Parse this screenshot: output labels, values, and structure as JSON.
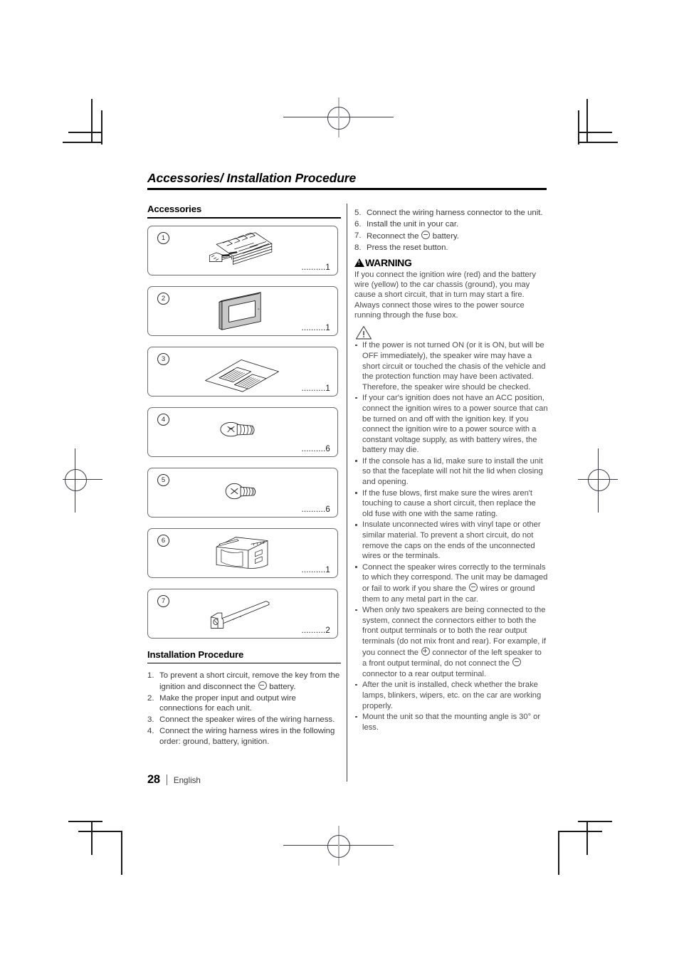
{
  "page": {
    "running_head": "Accessories/ Installation Procedure",
    "number": "28",
    "language": "English"
  },
  "accessories": {
    "section_title": "Accessories",
    "items": [
      {
        "number": "1",
        "qty": "..........1",
        "icon": "wiring-harness-icon"
      },
      {
        "number": "2",
        "qty": "..........1",
        "icon": "trim-plate-icon"
      },
      {
        "number": "3",
        "qty": "..........1",
        "icon": "label-sheet-icon"
      },
      {
        "number": "4",
        "qty": "..........6",
        "icon": "flat-head-screw-icon"
      },
      {
        "number": "5",
        "qty": "..........6",
        "icon": "pan-head-screw-icon"
      },
      {
        "number": "6",
        "qty": "..........1",
        "icon": "mounting-sleeve-icon"
      },
      {
        "number": "7",
        "qty": "..........2",
        "icon": "extraction-key-icon"
      }
    ]
  },
  "installation": {
    "section_title": "Installation Procedure",
    "steps_left": [
      {
        "n": "1.",
        "text_before": "To prevent a short circuit, remove the key from the ignition and disconnect the ",
        "symbol": "minus",
        "text_after": " battery."
      },
      {
        "n": "2.",
        "text_before": "Make the proper input and output wire connections for each unit.",
        "symbol": "",
        "text_after": ""
      },
      {
        "n": "3.",
        "text_before": "Connect the speaker wires of the wiring harness.",
        "symbol": "",
        "text_after": ""
      },
      {
        "n": "4.",
        "text_before": "Connect the wiring harness wires in the following order: ground, battery, ignition.",
        "symbol": "",
        "text_after": ""
      }
    ],
    "steps_right": [
      {
        "n": "5.",
        "text_before": "Connect the wiring harness connector to the unit.",
        "symbol": "",
        "text_after": ""
      },
      {
        "n": "6.",
        "text_before": "Install the unit in your car.",
        "symbol": "",
        "text_after": ""
      },
      {
        "n": "7.",
        "text_before": "Reconnect the ",
        "symbol": "minus",
        "text_after": " battery."
      },
      {
        "n": "8.",
        "text_before": "Press the reset button.",
        "symbol": "",
        "text_after": ""
      }
    ]
  },
  "warning": {
    "label": "WARNING",
    "body": "If you connect the ignition wire (red) and the battery wire (yellow) to the car chassis (ground), you may cause a short circuit, that in turn may start a fire. Always connect those wires to the power source running through the fuse box."
  },
  "caution": {
    "icon": "caution-triangle-icon",
    "bullets": [
      {
        "text_before": "If the power is not turned ON (or it is ON, but will be OFF immediately), the speaker wire may have a short circuit or touched the chasis of the vehicle and the protection function may have been activated. Therefore, the speaker wire should be checked.",
        "symbol": "",
        "text_mid": "",
        "symbol2": "",
        "text_after": ""
      },
      {
        "text_before": "If your car's ignition does not have an ACC position, connect the ignition wires to a power source that can be turned on and off with the ignition key. If you connect the ignition wire to a power source with a constant voltage supply, as with battery wires, the battery may die.",
        "symbol": "",
        "text_mid": "",
        "symbol2": "",
        "text_after": ""
      },
      {
        "text_before": "If the console has a lid, make sure to install the unit so that the faceplate will not hit the lid when closing and opening.",
        "symbol": "",
        "text_mid": "",
        "symbol2": "",
        "text_after": ""
      },
      {
        "text_before": "If the fuse blows, first make sure the wires aren't touching to cause a short circuit, then replace the old fuse with one with the same rating.",
        "symbol": "",
        "text_mid": "",
        "symbol2": "",
        "text_after": ""
      },
      {
        "text_before": "Insulate unconnected wires with vinyl tape or other similar material. To prevent a short circuit, do not remove the caps on the ends of the unconnected wires or the terminals.",
        "symbol": "",
        "text_mid": "",
        "symbol2": "",
        "text_after": ""
      },
      {
        "text_before": "Connect the speaker wires correctly to the terminals to which they correspond. The unit may be damaged or fail to work if you share the ",
        "symbol": "minus",
        "text_mid": " wires or ground them to any metal part in the car.",
        "symbol2": "",
        "text_after": ""
      },
      {
        "text_before": "When only two speakers are being connected to the system, connect the connectors either to both the front output terminals or to both the rear output terminals (do not mix front and rear). For example, if you connect the ",
        "symbol": "plus",
        "text_mid": " connector of the left speaker to a front output terminal, do not connect the ",
        "symbol2": "minus",
        "text_after": " connector to a rear output terminal."
      },
      {
        "text_before": "After the unit is installed, check whether the brake lamps, blinkers, wipers, etc. on the car are working properly.",
        "symbol": "",
        "text_mid": "",
        "symbol2": "",
        "text_after": ""
      },
      {
        "text_before": "Mount the unit so that the mounting angle is 30° or less.",
        "symbol": "",
        "text_mid": "",
        "symbol2": "",
        "text_after": ""
      }
    ]
  }
}
